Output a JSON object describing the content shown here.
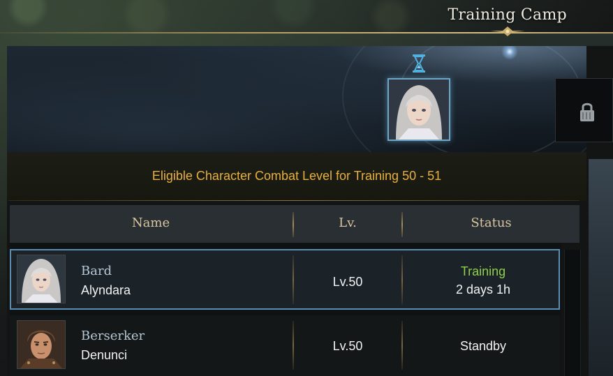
{
  "window": {
    "title": "Training Camp"
  },
  "banner": {
    "selected_character_icon": "bard-portrait",
    "timer_icon": "hourglass-icon",
    "locked_slot_icon": "lock-icon"
  },
  "eligibility": {
    "text": "Eligible Character Combat Level for Training 50 - 51"
  },
  "table": {
    "headers": {
      "name": "Name",
      "level": "Lv.",
      "status": "Status"
    },
    "rows": [
      {
        "class": "Bard",
        "name": "Alyndara",
        "level": "Lv.50",
        "status": "Training",
        "time": "2 days 1h",
        "status_color": "#8fd04a",
        "selected": true
      },
      {
        "class": "Berserker",
        "name": "Denunci",
        "level": "Lv.50",
        "status": "Standby",
        "time": "",
        "status_color": "#f2f2f2",
        "selected": false
      }
    ]
  },
  "colors": {
    "accent_gold": "#e8b040",
    "header_text": "#d8c6a0",
    "selection_border": "#5b8db0",
    "training_green": "#8fd04a"
  }
}
